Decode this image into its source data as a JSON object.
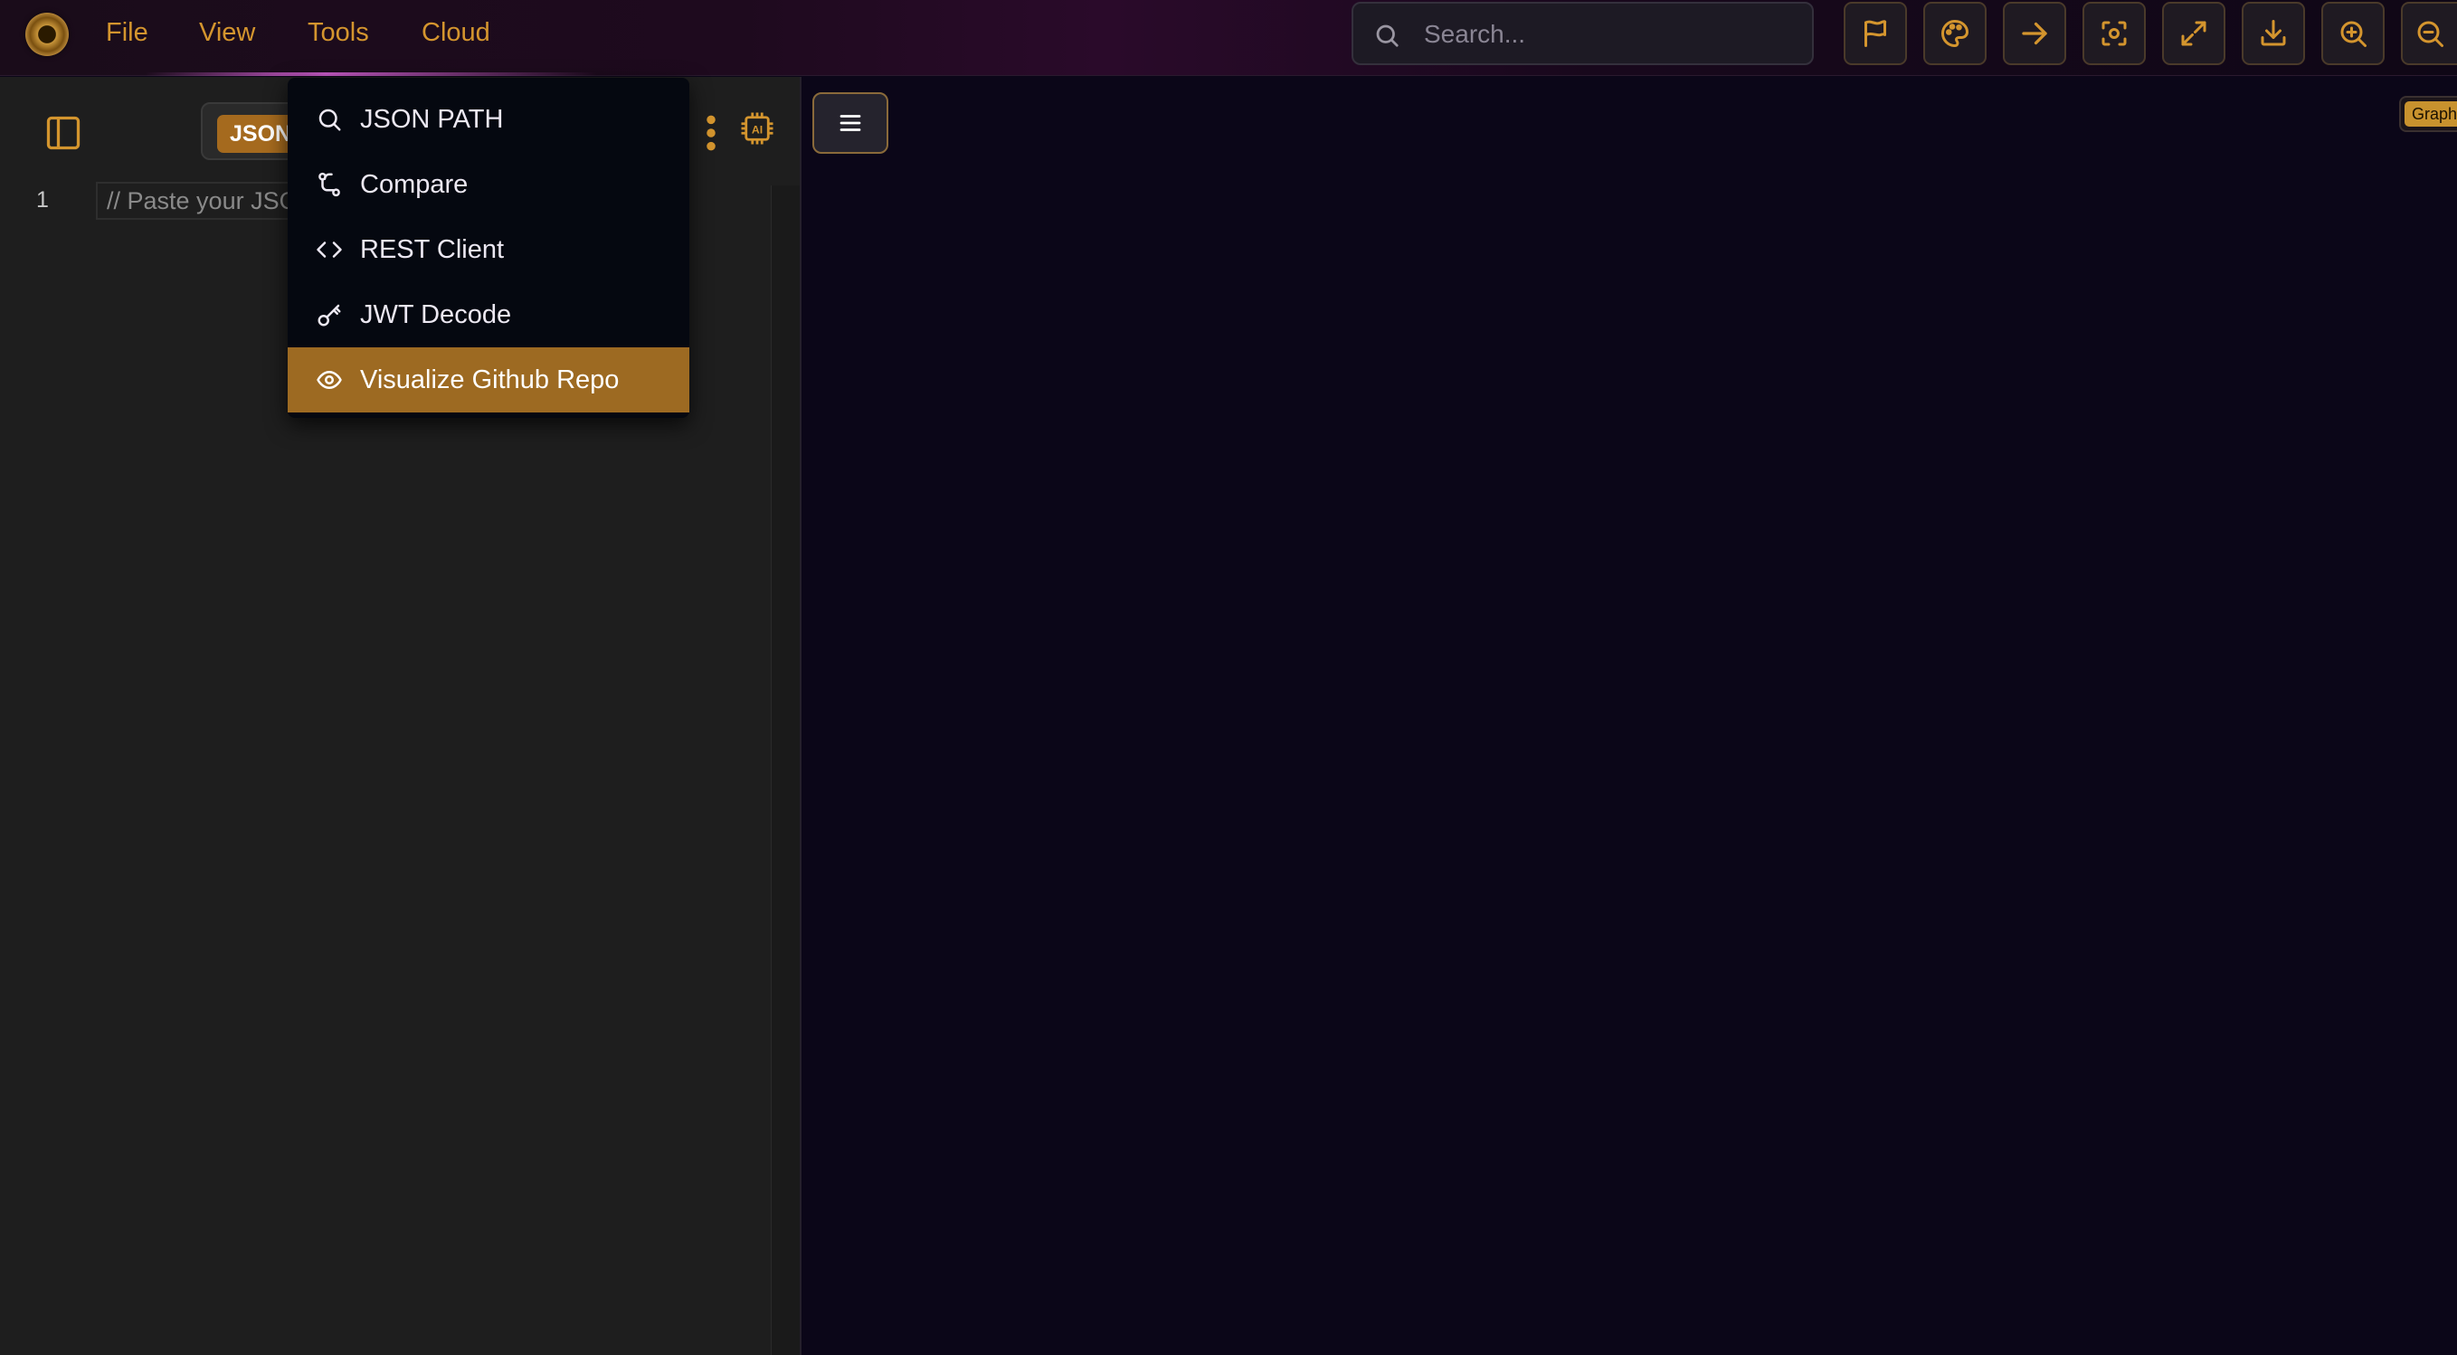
{
  "menubar": {
    "items": [
      {
        "label": "File"
      },
      {
        "label": "View"
      },
      {
        "label": "Tools"
      },
      {
        "label": "Cloud"
      }
    ]
  },
  "search": {
    "placeholder": "Search...",
    "value": ""
  },
  "toolbar": {
    "icons": [
      "flag-icon",
      "palette-icon",
      "arrow-right-icon",
      "focus-icon",
      "expand-icon",
      "download-icon",
      "zoom-in-icon",
      "zoom-out-icon"
    ]
  },
  "editor": {
    "format_active": "JSON",
    "line_number": "1",
    "placeholder_line": "// Paste your JSON here"
  },
  "tools_menu": {
    "items": [
      {
        "label": "JSON PATH",
        "icon": "search-icon"
      },
      {
        "label": "Compare",
        "icon": "git-compare-icon"
      },
      {
        "label": "REST Client",
        "icon": "code-icon"
      },
      {
        "label": "JWT Decode",
        "icon": "key-icon"
      },
      {
        "label": "Visualize Github Repo",
        "icon": "eye-icon"
      }
    ],
    "active_index": 4
  },
  "graph": {
    "badge": "Graph"
  },
  "colors": {
    "accent": "#d4952e",
    "highlight": "#9d6a22",
    "panel": "#1e1e1e",
    "canvas": "#0b0618"
  }
}
